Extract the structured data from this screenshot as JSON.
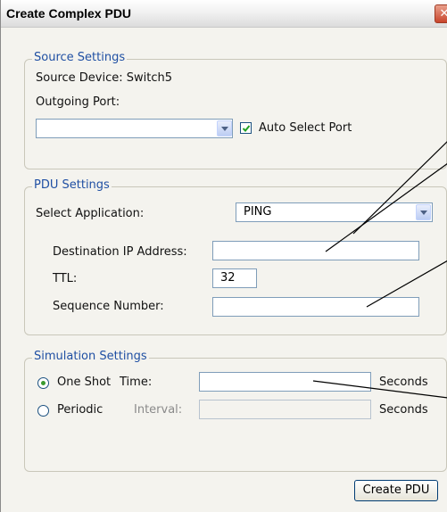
{
  "window": {
    "title": "Create Complex PDU",
    "close_glyph": "✕"
  },
  "source_settings": {
    "legend": "Source Settings",
    "source_device_label": "Source Device: Switch5",
    "outgoing_port_label": "Outgoing Port:",
    "outgoing_port_value": "",
    "auto_select_label": "Auto Select Port",
    "auto_select_checked": true
  },
  "pdu_settings": {
    "legend": "PDU Settings",
    "select_application_label": "Select Application:",
    "select_application_value": "PING",
    "dest_ip_label": "Destination IP Address:",
    "dest_ip_value": "",
    "ttl_label": "TTL:",
    "ttl_value": "32",
    "seq_label": "Sequence Number:",
    "seq_value": ""
  },
  "simulation_settings": {
    "legend": "Simulation Settings",
    "one_shot_label": "One Shot",
    "one_shot_selected": true,
    "time_label": "Time:",
    "time_value": "",
    "time_unit": "Seconds",
    "periodic_label": "Periodic",
    "interval_label": "Interval:",
    "interval_value": "",
    "interval_unit": "Seconds"
  },
  "footer": {
    "create_button": "Create PDU"
  },
  "colors": {
    "legend_text": "#1f4fa3",
    "annotation_lines": "#000000"
  }
}
